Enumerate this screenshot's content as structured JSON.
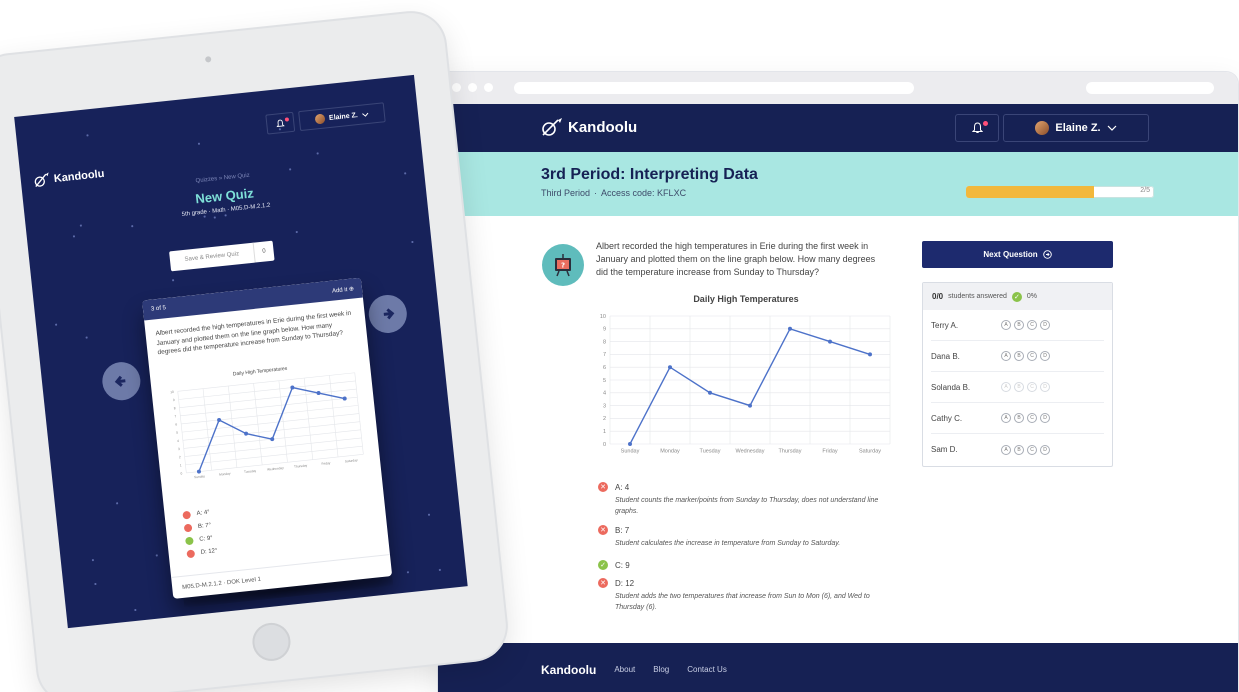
{
  "brand": {
    "name": "Kandoolu"
  },
  "user": {
    "name": "Elaine Z."
  },
  "desktop": {
    "title": "3rd Period: Interpreting Data",
    "subtitle_period": "Third Period",
    "subtitle_sep": "·",
    "subtitle_code": "Access code: KFLXC",
    "progress": {
      "fraction": 0.68,
      "label": "2/5"
    },
    "question": "Albert recorded the high temperatures in Erie during the first week in January and plotted them on the line graph below. How many degrees did the temperature increase from Sunday to Thursday?",
    "options": [
      {
        "label": "A: 4",
        "status": "wrong",
        "explanation": "Student counts the marker/points from Sunday to Thursday, does not understand line graphs."
      },
      {
        "label": "B: 7",
        "status": "wrong",
        "explanation": "Student calculates the increase in temperature from Sunday to Saturday."
      },
      {
        "label": "C: 9",
        "status": "correct",
        "explanation": ""
      },
      {
        "label": "D: 12",
        "status": "wrong",
        "explanation": "Student adds the two temperatures that increase from Sun to Mon (6), and Wed to Thursday (6)."
      }
    ],
    "next_button": "Next Question",
    "answers_count": "0/0",
    "answers_label": "students answered",
    "answers_pct": "0%",
    "students": [
      {
        "name": "Terry A.",
        "dim": false
      },
      {
        "name": "Dana B.",
        "dim": false
      },
      {
        "name": "Solanda B.",
        "dim": true
      },
      {
        "name": "Cathy C.",
        "dim": false
      },
      {
        "name": "Sam D.",
        "dim": false
      }
    ],
    "choice_letters": [
      "A",
      "B",
      "C",
      "D"
    ],
    "footer": {
      "brand": "Kandoolu",
      "links": [
        "About",
        "Blog",
        "Contact Us"
      ]
    }
  },
  "tablet": {
    "breadcrumb": "Quizzes » New Quiz",
    "title": "New Quiz",
    "meta": "5th grade · Math · M05.D-M.2.1.2",
    "save_label": "Save & Review Quiz",
    "save_count": "0",
    "card_counter": "3 of 5",
    "card_add": "Add it",
    "card_question": "Albert recorded the high temperatures in Erie during the first week in January and plotted them on the line graph below. How many degrees did the temperature increase from Sunday to Thursday?",
    "chart_title": "Daily High Temperatures",
    "options": [
      {
        "label": "A: 4°",
        "status": "wrong"
      },
      {
        "label": "B: 7°",
        "status": "wrong"
      },
      {
        "label": "C: 9°",
        "status": "correct"
      },
      {
        "label": "D: 12°",
        "status": "wrong"
      }
    ],
    "card_footer": "M05.D-M.2.1.2 · DOK Level 1"
  },
  "colors": {
    "navy": "#162154",
    "teal": "#a9e7e2",
    "accent_teal": "#7ee0d8",
    "progress": "#f2b83c",
    "wrong": "#ec6a5e",
    "correct": "#8bc34a",
    "line": "#4d72c9"
  },
  "chart_data": {
    "type": "line",
    "title": "Daily High Temperatures",
    "categories": [
      "Sunday",
      "Monday",
      "Tuesday",
      "Wednesday",
      "Thursday",
      "Friday",
      "Saturday"
    ],
    "values": [
      0,
      6,
      4,
      3,
      9,
      8,
      7
    ],
    "ylim": [
      0,
      10
    ],
    "yticks": [
      0,
      1,
      2,
      3,
      4,
      5,
      6,
      7,
      8,
      9,
      10
    ],
    "grid": true,
    "xlabel": "",
    "ylabel": ""
  }
}
